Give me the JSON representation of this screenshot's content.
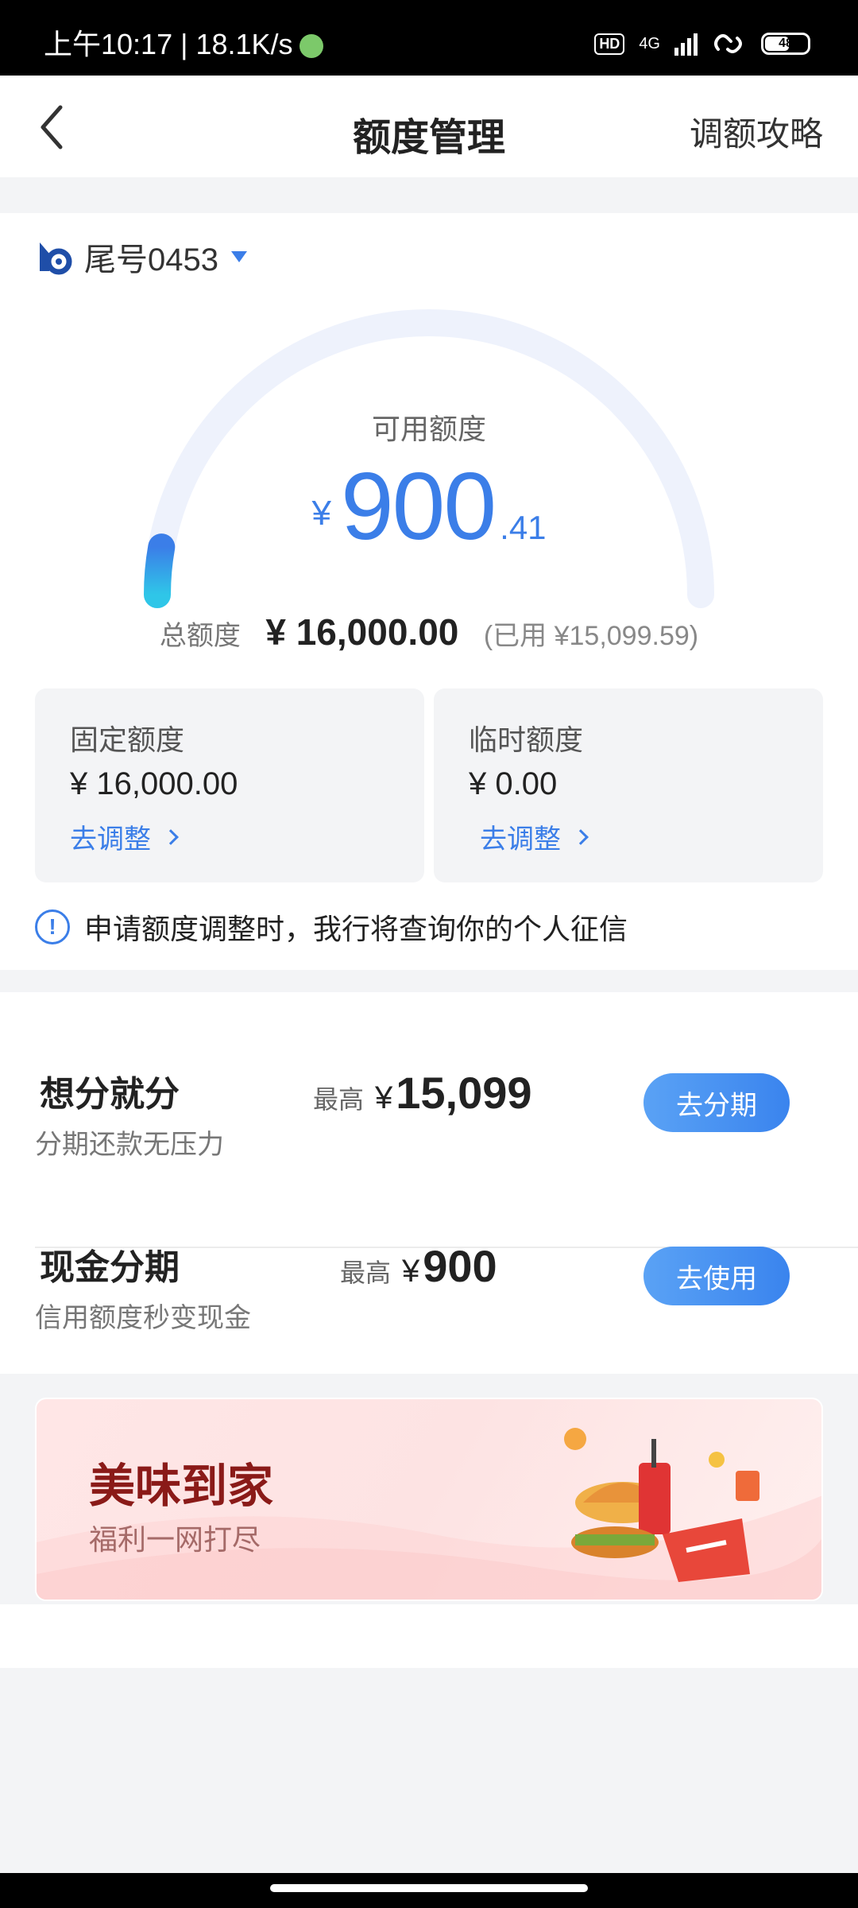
{
  "status_bar": {
    "time": "上午10:17 | 18.1K/s",
    "hd": "HD",
    "network": "4G",
    "battery": "48"
  },
  "header": {
    "title": "额度管理",
    "right_link": "调额攻略"
  },
  "account": {
    "label": "尾号0453"
  },
  "gauge": {
    "label": "可用额度",
    "currency": "¥",
    "amount_int": "900",
    "amount_dec": ".41",
    "fill_fraction": 0.056
  },
  "total": {
    "label": "总额度",
    "value": "¥ 16,000.00",
    "used": "(已用 ¥15,099.59)"
  },
  "limits": [
    {
      "label": "固定额度",
      "value": "¥ 16,000.00",
      "action": "去调整"
    },
    {
      "label": "临时额度",
      "value": "¥ 0.00",
      "action": "去调整"
    }
  ],
  "notice": {
    "text": "申请额度调整时，我行将查询你的个人征信"
  },
  "offers": [
    {
      "title": "想分就分",
      "subtitle": "分期还款无压力",
      "max_label": "最高",
      "currency": "¥",
      "max_value": "15,099",
      "button": "去分期"
    },
    {
      "title": "现金分期",
      "subtitle": "信用额度秒变现金",
      "max_label": "最高",
      "currency": "¥",
      "max_value": "900",
      "button": "去使用"
    }
  ],
  "banner": {
    "title": "美味到家",
    "subtitle": "福利一网打尽"
  },
  "colors": {
    "accent": "#3b7ee8",
    "gauge_track": "#eef2fc",
    "gauge_fill_start": "#2fc6e8",
    "gauge_fill_end": "#3b7ee8",
    "banner_title": "#8a1a18"
  }
}
